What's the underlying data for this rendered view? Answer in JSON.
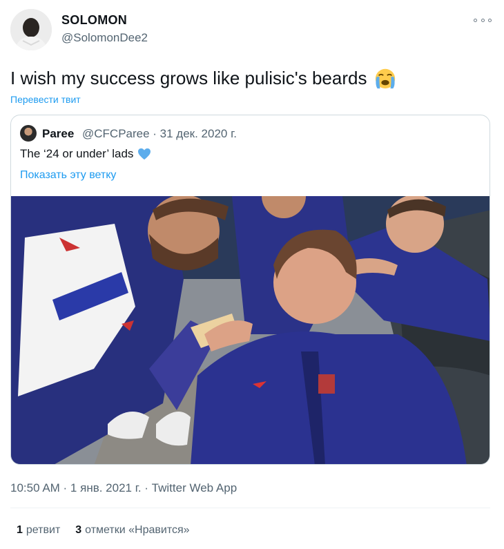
{
  "author": {
    "display_name": "SOLOMON",
    "handle": "@SolomonDee2"
  },
  "tweet": {
    "text": "I wish my success grows like pulisic's beards",
    "emoji": "loudly-crying-face-emoji",
    "translate_label": "Перевести твит"
  },
  "quoted_tweet": {
    "display_name": "Paree",
    "handle_and_date": "@CFCParee · 31 дек. 2020 г.",
    "text": "The ‘24 or under’ lads",
    "emoji": "blue-heart-emoji",
    "show_thread_label": "Показать эту ветку"
  },
  "meta": {
    "timestamp": "10:50 AM · 1 янв. 2021 г. · Twitter Web App"
  },
  "stats": {
    "retweets_count": "1",
    "retweets_label": "ретвит",
    "likes_count": "3",
    "likes_label": "отметки «Нравится»"
  },
  "colors": {
    "link": "#1d9bf0",
    "secondary_text": "#536471",
    "border": "#cfd9de"
  }
}
